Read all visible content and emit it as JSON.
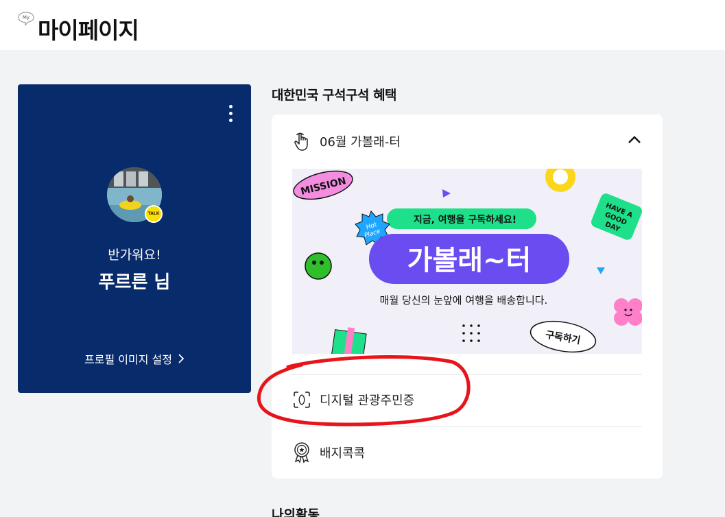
{
  "header": {
    "title": "마이페이지",
    "icon_text": "My"
  },
  "profile": {
    "greeting": "반가워요!",
    "name": "푸르른 님",
    "setting_label": "프로필 이미지 설정",
    "badge_text": "TALK"
  },
  "benefits": {
    "section_title": "대한민국 구석구석 혜택",
    "subscription_item": "06월 가볼래-터",
    "banner": {
      "mission": "MISSION",
      "hot_place": "Hot Place",
      "tagline": "지금, 여행을 구독하세요!",
      "headline": "가볼래~터",
      "description": "매월  당신의 눈앞에 여행을 배송합니다.",
      "subscribe_label": "구독하기",
      "good_day": "HAVE A GOOD DAY"
    },
    "items": [
      {
        "label": "디지털 관광주민증",
        "icon": "id-scan-icon"
      },
      {
        "label": "배지콕콕",
        "icon": "badge-icon"
      }
    ]
  },
  "next_section_title": "나의활동",
  "colors": {
    "card_navy": "#082b6b",
    "headline_purple": "#6a4cf0",
    "mint": "#1fe08a",
    "highlight_red": "#e8141c"
  }
}
